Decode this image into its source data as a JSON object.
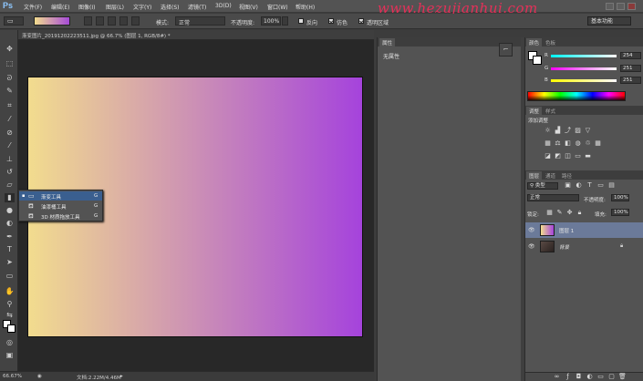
{
  "app": {
    "logo": "Ps"
  },
  "menu": [
    "文件(F)",
    "编辑(E)",
    "图像(I)",
    "图层(L)",
    "文字(Y)",
    "选择(S)",
    "滤镜(T)",
    "3D(D)",
    "视图(V)",
    "窗口(W)",
    "帮助(H)"
  ],
  "watermark": "www.hezujianhui.com",
  "options": {
    "mode_label": "模式:",
    "mode_value": "正常",
    "opacity_label": "不透明度:",
    "opacity_value": "100%",
    "reverse_label": "反向",
    "dither_label": "仿色",
    "transparency_label": "透明区域",
    "workspace": "基本功能"
  },
  "document": {
    "tab_title": "渐变图片_20191202223511.jpg @ 66.7% (图层 1, RGB/8#) *",
    "zoom": "66.67%",
    "doc_size": "文档:2.22M/4.46M",
    "gradient_start": "#f2dc8e",
    "gradient_end": "#a543dc"
  },
  "flyout": {
    "items": [
      {
        "label": "渐变工具",
        "key": "G",
        "icon": "gradient-tool-icon",
        "selected": true
      },
      {
        "label": "油漆桶工具",
        "key": "G",
        "icon": "paint-bucket-icon",
        "selected": false
      },
      {
        "label": "3D 材质拖放工具",
        "key": "G",
        "icon": "3d-material-drop-icon",
        "selected": false
      }
    ]
  },
  "properties": {
    "tab_properties": "属性",
    "tab_info": "信息",
    "no_properties": "无属性"
  },
  "color_panel": {
    "tab_color": "颜色",
    "tab_swatches": "色板",
    "r_label": "R",
    "r_value": "254",
    "g_label": "G",
    "g_value": "251",
    "b_label": "B",
    "b_value": "251"
  },
  "adjustments": {
    "tab_adjust": "调整",
    "tab_styles": "样式",
    "title": "添加调整"
  },
  "layers_panel": {
    "tab_layers": "图层",
    "tab_channels": "通道",
    "tab_paths": "路径",
    "filter_label": "类型",
    "blend_mode": "正常",
    "opacity_label": "不透明度:",
    "opacity_value": "100%",
    "lock_label": "锁定:",
    "fill_label": "填充:",
    "fill_value": "100%",
    "layers": [
      {
        "name": "图层 1",
        "selected": true
      },
      {
        "name": "背景",
        "selected": false
      }
    ]
  }
}
